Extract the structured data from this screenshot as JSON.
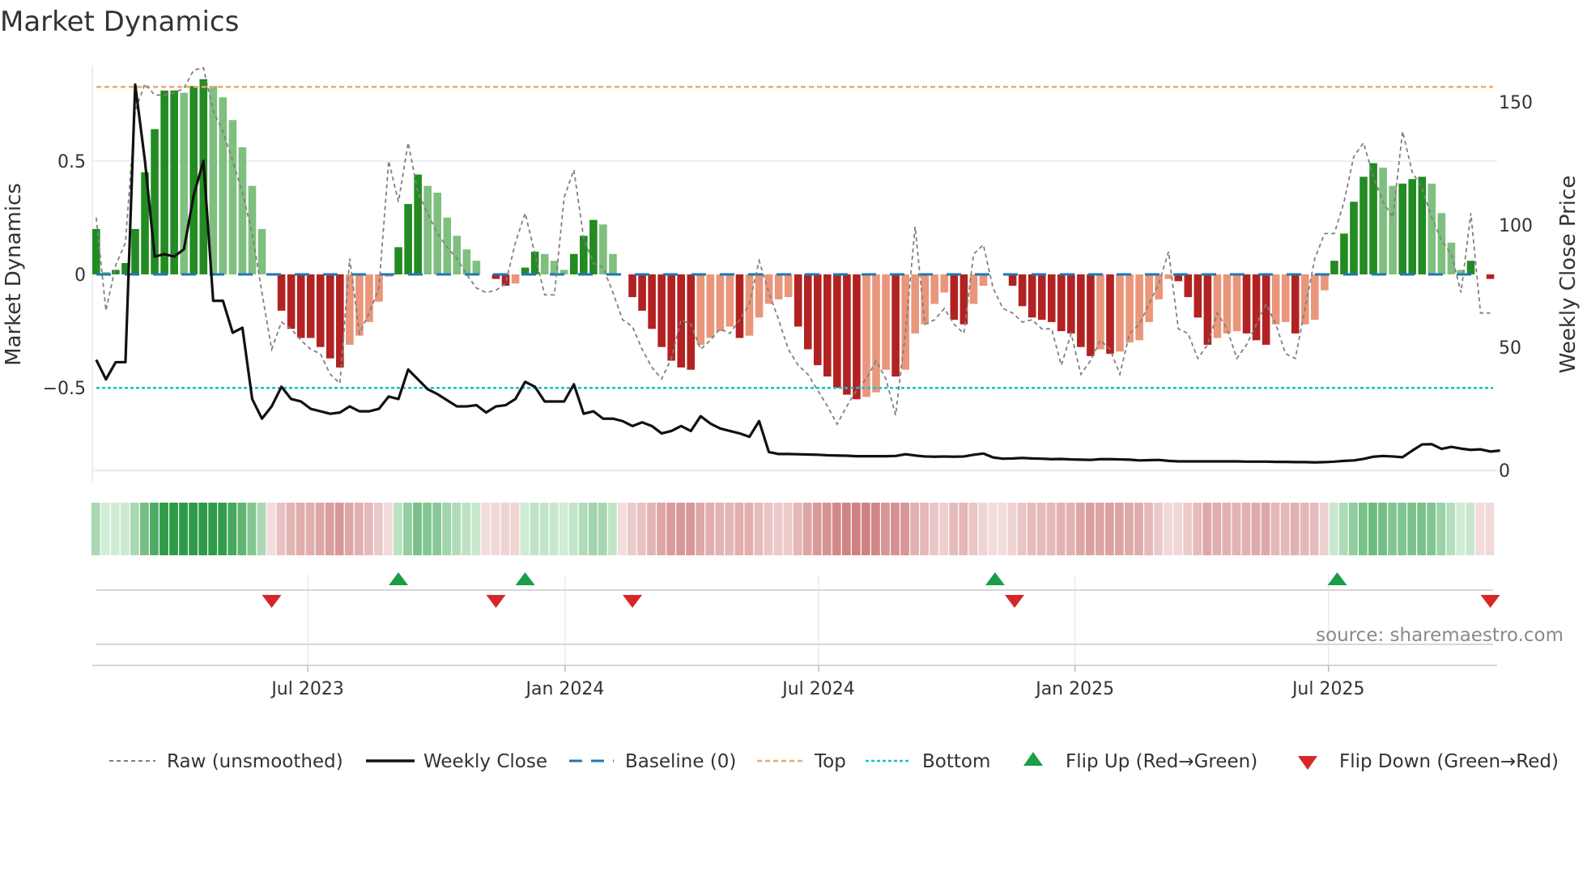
{
  "title": "Market Dynamics",
  "source": "source: sharemaestro.com",
  "colors": {
    "dark_green": "#228b22",
    "light_green": "#7fbf7f",
    "dark_red": "#b22222",
    "light_red": "#e9967a",
    "raw": "#808080",
    "close": "#111111",
    "baseline": "#1f77b4",
    "top": "#f0a868",
    "bottom": "#17becf",
    "flip_up": "#1a9e48",
    "flip_down": "#d62728"
  },
  "chart_data": {
    "type": "bar",
    "title": "Market Dynamics",
    "ylabel": "Market Dynamics",
    "y2label": "Weekly Close Price",
    "frequency": "weekly",
    "ylim": [
      -0.92,
      0.92
    ],
    "y2lim": [
      -5.3,
      164.8
    ],
    "xlim": [
      -0.4,
      143.7
    ],
    "yticks": [
      {
        "value": 0.5,
        "label": "0.5"
      },
      {
        "value": 0,
        "label": "0"
      },
      {
        "value": -0.5,
        "label": "−0.5"
      }
    ],
    "y2ticks": [
      {
        "value": 150,
        "label": "150"
      },
      {
        "value": 100,
        "label": "100"
      },
      {
        "value": 50,
        "label": "50"
      },
      {
        "value": 0,
        "label": "0"
      }
    ],
    "xticks": [
      {
        "week": 21.7,
        "label": "Jul 2023"
      },
      {
        "week": 48.1,
        "label": "Jan 2024"
      },
      {
        "week": 74.1,
        "label": "Jul 2024"
      },
      {
        "week": 100.4,
        "label": "Jan 2025"
      },
      {
        "week": 126.4,
        "label": "Jul 2025"
      }
    ],
    "top": 0.826,
    "bottom": -0.5,
    "baseline": 0,
    "dynamics": [
      0.2,
      0.01,
      0.02,
      0.05,
      0.2,
      0.45,
      0.64,
      0.81,
      0.81,
      0.8,
      0.83,
      0.86,
      0.83,
      0.78,
      0.68,
      0.56,
      0.39,
      0.2,
      0.0,
      -0.16,
      -0.24,
      -0.28,
      -0.28,
      -0.32,
      -0.37,
      -0.41,
      -0.31,
      -0.27,
      -0.21,
      -0.12,
      -0.01,
      0.12,
      0.31,
      0.44,
      0.39,
      0.36,
      0.25,
      0.17,
      0.11,
      0.06,
      0.0,
      -0.02,
      -0.05,
      -0.04,
      0.03,
      0.1,
      0.09,
      0.06,
      0.02,
      0.09,
      0.17,
      0.24,
      0.22,
      0.09,
      0.0,
      -0.1,
      -0.16,
      -0.24,
      -0.32,
      -0.38,
      -0.41,
      -0.42,
      -0.31,
      -0.28,
      -0.25,
      -0.23,
      -0.28,
      -0.27,
      -0.19,
      -0.13,
      -0.11,
      -0.1,
      -0.23,
      -0.33,
      -0.4,
      -0.45,
      -0.5,
      -0.53,
      -0.55,
      -0.54,
      -0.52,
      -0.42,
      -0.45,
      -0.42,
      -0.26,
      -0.22,
      -0.13,
      -0.08,
      -0.2,
      -0.22,
      -0.13,
      -0.05,
      0.0,
      0.0,
      -0.05,
      -0.14,
      -0.19,
      -0.2,
      -0.21,
      -0.25,
      -0.26,
      -0.32,
      -0.36,
      -0.33,
      -0.35,
      -0.34,
      -0.3,
      -0.29,
      -0.21,
      -0.11,
      -0.02,
      -0.03,
      -0.1,
      -0.19,
      -0.31,
      -0.28,
      -0.26,
      -0.25,
      -0.26,
      -0.29,
      -0.31,
      -0.22,
      -0.21,
      -0.26,
      -0.22,
      -0.2,
      -0.07,
      0.06,
      0.18,
      0.32,
      0.43,
      0.49,
      0.47,
      0.39,
      0.4,
      0.42,
      0.43,
      0.4,
      0.27,
      0.14,
      0.02,
      0.06,
      0.0,
      -0.02
    ],
    "raw": [
      0.25,
      -0.16,
      0.04,
      0.14,
      0.72,
      0.84,
      0.79,
      0.79,
      0.8,
      0.82,
      0.9,
      0.91,
      0.72,
      0.63,
      0.5,
      0.36,
      0.18,
      -0.08,
      -0.33,
      -0.21,
      -0.24,
      -0.29,
      -0.33,
      -0.35,
      -0.44,
      -0.48,
      0.07,
      -0.26,
      -0.17,
      -0.06,
      0.5,
      0.32,
      0.58,
      0.36,
      0.27,
      0.18,
      0.12,
      0.07,
      0.0,
      -0.06,
      -0.08,
      -0.07,
      -0.04,
      0.14,
      0.27,
      0.09,
      -0.09,
      -0.09,
      0.34,
      0.46,
      0.16,
      0.05,
      0.03,
      -0.08,
      -0.2,
      -0.23,
      -0.33,
      -0.41,
      -0.46,
      -0.37,
      -0.2,
      -0.22,
      -0.33,
      -0.29,
      -0.24,
      -0.26,
      -0.2,
      -0.13,
      0.06,
      -0.08,
      -0.2,
      -0.33,
      -0.4,
      -0.44,
      -0.51,
      -0.58,
      -0.66,
      -0.58,
      -0.51,
      -0.46,
      -0.38,
      -0.46,
      -0.62,
      -0.26,
      0.21,
      -0.22,
      -0.2,
      -0.15,
      -0.22,
      -0.26,
      0.09,
      0.13,
      -0.06,
      -0.15,
      -0.17,
      -0.21,
      -0.2,
      -0.24,
      -0.24,
      -0.4,
      -0.26,
      -0.44,
      -0.38,
      -0.29,
      -0.33,
      -0.44,
      -0.26,
      -0.22,
      -0.13,
      -0.04,
      0.1,
      -0.24,
      -0.26,
      -0.37,
      -0.31,
      -0.17,
      -0.24,
      -0.37,
      -0.31,
      -0.22,
      -0.13,
      -0.22,
      -0.35,
      -0.37,
      -0.15,
      0.07,
      0.18,
      0.18,
      0.32,
      0.52,
      0.58,
      0.43,
      0.32,
      0.25,
      0.63,
      0.45,
      0.38,
      0.25,
      0.15,
      0.09,
      -0.08,
      0.27,
      -0.17,
      -0.17
    ],
    "weekly_close": [
      45,
      37,
      44,
      44,
      157,
      126,
      87,
      88,
      87,
      90,
      112,
      126,
      69,
      69,
      56,
      58,
      29,
      21,
      26,
      34,
      29,
      28,
      25,
      24,
      23,
      23.5,
      26,
      24,
      24,
      25,
      30,
      29,
      41,
      37,
      33,
      31,
      28.5,
      26,
      26,
      26.5,
      23.5,
      26,
      26.5,
      29,
      36,
      34,
      28,
      28,
      28,
      35,
      23,
      24,
      21,
      21,
      20,
      18,
      19.5,
      18,
      15,
      16,
      18,
      16,
      22,
      19,
      17,
      16,
      15,
      13.6,
      20,
      7.4,
      6.6,
      6.6,
      6.5,
      6.4,
      6.3,
      6.1,
      6.0,
      5.9,
      5.7,
      5.7,
      5.7,
      5.7,
      5.8,
      6.5,
      6.0,
      5.6,
      5.5,
      5.6,
      5.5,
      5.6,
      6.3,
      6.8,
      5.2,
      4.7,
      4.8,
      5.0,
      4.8,
      4.7,
      4.5,
      4.6,
      4.4,
      4.3,
      4.2,
      4.5,
      4.5,
      4.4,
      4.3,
      4.0,
      4.1,
      4.2,
      3.8,
      3.6,
      3.6,
      3.6,
      3.6,
      3.6,
      3.6,
      3.6,
      3.5,
      3.5,
      3.5,
      3.4,
      3.4,
      3.3,
      3.3,
      3.2,
      3.3,
      3.5,
      3.8,
      4.0,
      4.6,
      5.5,
      5.8,
      5.6,
      5.3,
      8.0,
      10.5,
      10.6,
      8.7,
      9.5,
      8.8,
      8.3,
      8.5,
      7.6,
      8.0
    ],
    "flips_up": [
      31.0,
      44.0,
      92.2,
      127.3
    ],
    "flips_down": [
      18.0,
      41.0,
      55.0,
      94.2,
      143.0
    ],
    "legend": {
      "placement": "bottom",
      "items": [
        "Raw (unsmoothed)",
        "Weekly Close",
        "Baseline (0)",
        "Top",
        "Bottom",
        "Flip Up (Red→Green)",
        "Flip Down (Green→Red)"
      ]
    }
  }
}
